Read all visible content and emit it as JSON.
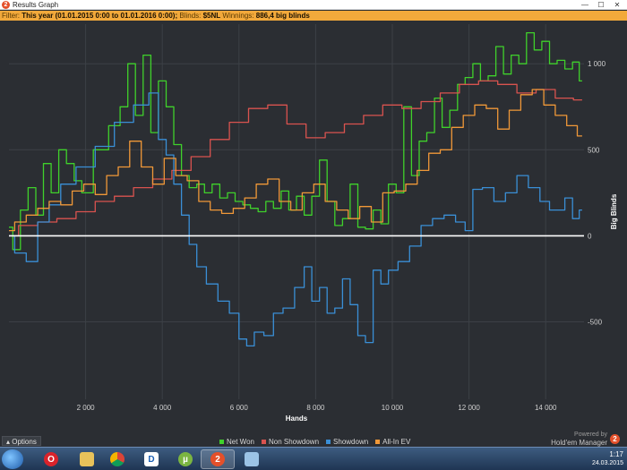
{
  "window": {
    "title": "Results Graph",
    "buttons": {
      "minimize": "—",
      "maximize": "☐",
      "close": "✕"
    }
  },
  "filter": {
    "label": "Filter:",
    "period": "This year (01.01.2015 0:00 to 01.01.2016 0:00);",
    "blinds_label": "Blinds:",
    "blinds_value": "$5NL",
    "winnings_label": "Winnings:",
    "winnings_value": "886,4 big blinds"
  },
  "chart_data": {
    "type": "line",
    "xlabel": "Hands",
    "ylabel": "Big Blinds",
    "xlim": [
      0,
      15000
    ],
    "ylim": [
      -950,
      1230
    ],
    "xticks": [
      2000,
      4000,
      6000,
      8000,
      10000,
      12000,
      14000
    ],
    "xtick_labels": [
      "2 000",
      "4 000",
      "6 000",
      "8 000",
      "10 000",
      "12 000",
      "14 000"
    ],
    "yticks": [
      -500,
      0,
      500,
      1000
    ],
    "ytick_labels": [
      "-500",
      "0",
      "500",
      "1 000"
    ],
    "grid": true,
    "legend_position": "bottom",
    "series": [
      {
        "name": "Net Won",
        "color": "#3fd12b",
        "x": [
          0,
          200,
          400,
          600,
          800,
          1000,
          1200,
          1400,
          1600,
          1800,
          2000,
          2400,
          2800,
          3000,
          3200,
          3400,
          3600,
          3800,
          4000,
          4200,
          4400,
          4600,
          4800,
          5000,
          5200,
          5400,
          5600,
          5800,
          6000,
          6200,
          6400,
          6600,
          6800,
          7000,
          7200,
          7400,
          7600,
          7800,
          8000,
          8200,
          8400,
          8600,
          8800,
          9000,
          9200,
          9400,
          9600,
          9800,
          10000,
          10200,
          10400,
          10600,
          10800,
          11000,
          11200,
          11400,
          11600,
          11800,
          12000,
          12200,
          12400,
          12600,
          12800,
          13000,
          13200,
          13400,
          13600,
          13800,
          14000,
          14200,
          14400,
          14600,
          14800,
          14950
        ],
        "y": [
          50,
          -80,
          150,
          280,
          120,
          420,
          250,
          500,
          420,
          320,
          250,
          500,
          640,
          750,
          1000,
          700,
          1050,
          600,
          900,
          750,
          530,
          350,
          280,
          300,
          250,
          300,
          220,
          250,
          200,
          180,
          160,
          140,
          200,
          160,
          260,
          150,
          230,
          120,
          230,
          440,
          200,
          60,
          100,
          300,
          50,
          40,
          150,
          70,
          300,
          250,
          750,
          350,
          550,
          600,
          800,
          630,
          730,
          880,
          920,
          1000,
          900,
          930,
          1100,
          940,
          1050,
          1000,
          1180,
          1080,
          1130,
          1000,
          1020,
          970,
          1010,
          900
        ]
      },
      {
        "name": "Non Showdown",
        "color": "#d9534f",
        "x": [
          0,
          500,
          1000,
          1500,
          2000,
          2500,
          3000,
          3500,
          4000,
          4500,
          5000,
          5500,
          6000,
          6500,
          7000,
          7500,
          8000,
          8500,
          9000,
          9500,
          10000,
          10500,
          11000,
          11500,
          12000,
          12500,
          13000,
          13500,
          14000,
          14500,
          14950
        ],
        "y": [
          0,
          60,
          80,
          100,
          140,
          200,
          230,
          280,
          330,
          380,
          460,
          560,
          660,
          740,
          760,
          650,
          570,
          600,
          650,
          700,
          760,
          740,
          780,
          830,
          880,
          900,
          880,
          830,
          850,
          800,
          790
        ]
      },
      {
        "name": "Showdown",
        "color": "#3a8fd6",
        "x": [
          0,
          300,
          600,
          900,
          1200,
          1500,
          2000,
          2500,
          3000,
          3500,
          3800,
          4000,
          4200,
          4400,
          4600,
          4800,
          5000,
          5300,
          5600,
          5900,
          6100,
          6300,
          6500,
          6800,
          7000,
          7300,
          7600,
          7800,
          8000,
          8200,
          8400,
          8600,
          8800,
          9000,
          9200,
          9400,
          9600,
          9800,
          10000,
          10300,
          10600,
          10900,
          11200,
          11500,
          11800,
          12000,
          12200,
          12500,
          12800,
          13100,
          13400,
          13700,
          14000,
          14200,
          14400,
          14600,
          14800,
          14950
        ],
        "y": [
          0,
          -100,
          -150,
          80,
          180,
          300,
          400,
          520,
          660,
          760,
          830,
          560,
          470,
          300,
          120,
          -50,
          -180,
          -280,
          -380,
          -450,
          -600,
          -640,
          -560,
          -580,
          -450,
          -420,
          -300,
          -180,
          -380,
          -300,
          -450,
          -420,
          -250,
          -400,
          -580,
          -620,
          -200,
          -280,
          -200,
          -150,
          -60,
          60,
          100,
          120,
          80,
          30,
          270,
          280,
          200,
          250,
          350,
          280,
          200,
          150,
          150,
          220,
          100,
          150
        ]
      },
      {
        "name": "All-In EV",
        "color": "#f09838",
        "x": [
          0,
          300,
          600,
          900,
          1200,
          1500,
          1800,
          2100,
          2400,
          2700,
          3000,
          3300,
          3600,
          3900,
          4200,
          4500,
          4800,
          5100,
          5400,
          5700,
          6000,
          6300,
          6600,
          6900,
          7200,
          7500,
          7800,
          8100,
          8400,
          8700,
          9000,
          9300,
          9600,
          9900,
          10200,
          10500,
          10800,
          11100,
          11400,
          11700,
          12000,
          12300,
          12600,
          12900,
          13200,
          13500,
          13800,
          14100,
          14400,
          14700,
          14950
        ],
        "y": [
          30,
          80,
          120,
          160,
          200,
          180,
          260,
          300,
          240,
          350,
          400,
          550,
          400,
          300,
          450,
          350,
          320,
          200,
          150,
          130,
          160,
          220,
          300,
          330,
          200,
          150,
          250,
          300,
          200,
          150,
          100,
          170,
          80,
          250,
          260,
          300,
          380,
          480,
          500,
          630,
          700,
          760,
          740,
          620,
          730,
          820,
          850,
          760,
          700,
          640,
          580
        ]
      }
    ]
  },
  "options_label": "Options",
  "brand": {
    "powered_by": "Powered by",
    "name": "Hold'em Manager"
  },
  "taskbar": {
    "time": "1:17",
    "date": "24.03.2015"
  }
}
